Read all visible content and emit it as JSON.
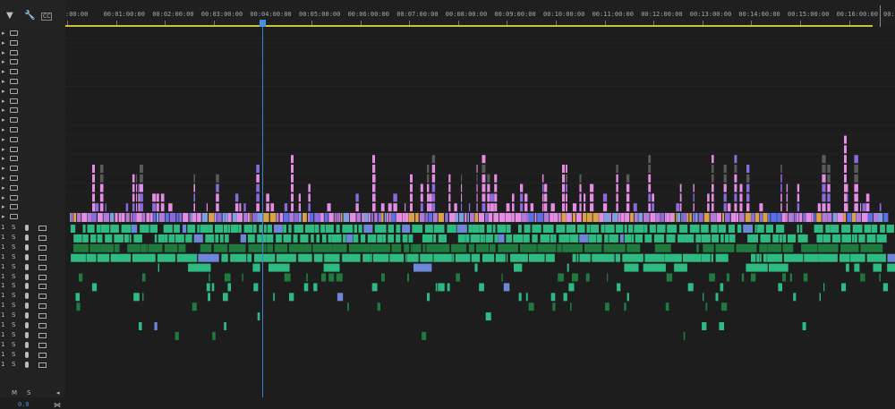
{
  "ruler": {
    "timecodes": [
      ":00:00",
      "00:01:00:00",
      "00:02:00:00",
      "00:03:00:00",
      "00:04:00:00",
      "00:05:00:00",
      "00:06:00:00",
      "00:07:00:00",
      "00:08:00:00",
      "00:09:00:00",
      "00:10:00:00",
      "00:11:00:00",
      "00:12:00:00",
      "00:13:00:00",
      "00:14:00:00",
      "00:15:00:00",
      "00:16:00:00"
    ],
    "end_label": "00:17"
  },
  "playhead": {
    "time_minutes": 4.0
  },
  "sequence_length_minutes": 16.8,
  "toolbar": {
    "snap_icon": "snap-magnet-icon",
    "wrench_icon": "wrench-icon",
    "captions_icon": "captions-icon"
  },
  "video_tracks": {
    "count": 20,
    "toggle_icon": "track-toggle-icon",
    "eye_icon": "film-strip-icon"
  },
  "audio_tracks": {
    "count": 15,
    "lock_label": "1",
    "solo_label": "S",
    "mic_icon": "mic-icon",
    "vu_icon": "track-output-icon"
  },
  "mix": {
    "m_label": "M",
    "s_label": "S",
    "volume": "0.0"
  },
  "colors": {
    "video_pink": "#e38ee3",
    "video_violet": "#8a6bd9",
    "video_blue": "#5b6fe6",
    "audio_green": "#2dbb82",
    "audio_dark_green": "#1f7a3e",
    "playhead": "#3b7fd6",
    "work_area": "#c9c23a"
  }
}
